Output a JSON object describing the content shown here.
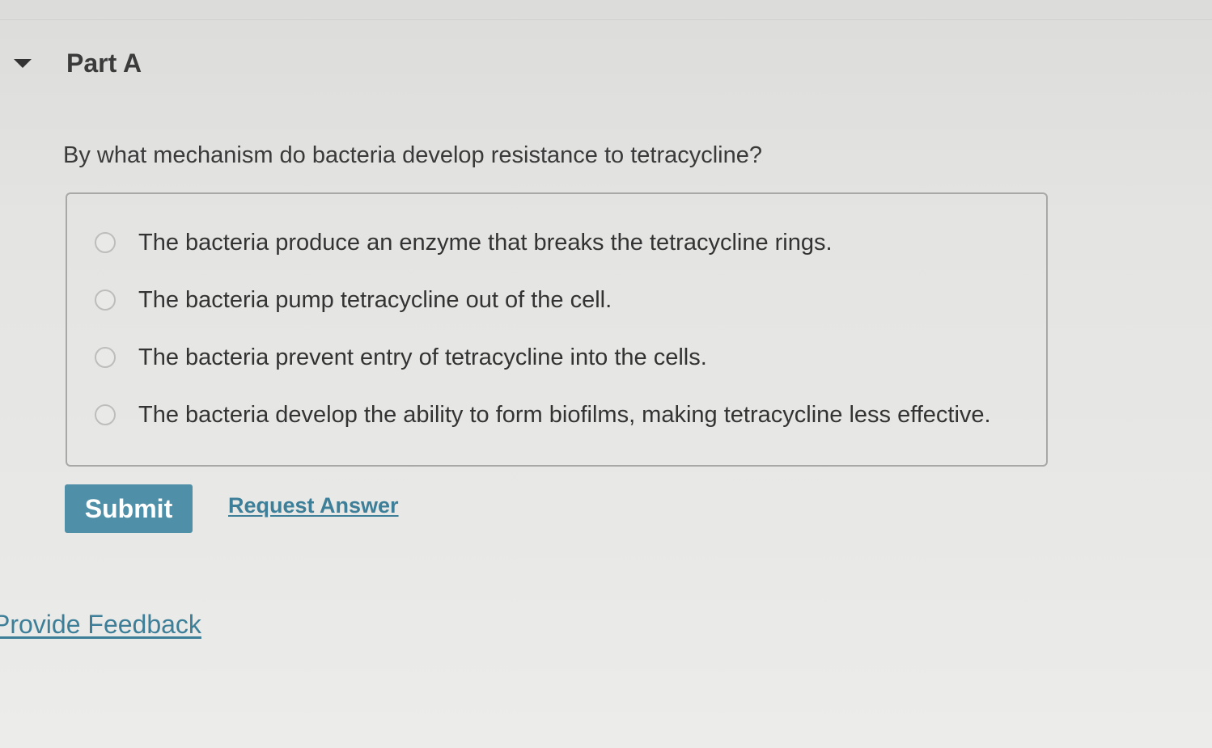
{
  "part": {
    "title": "Part A",
    "collapse_icon": "caret-down-icon"
  },
  "question": {
    "text": "By what mechanism do bacteria develop resistance to tetracycline?"
  },
  "options": [
    {
      "label": "The bacteria produce an enzyme that breaks the tetracycline rings.",
      "selected": false
    },
    {
      "label": "The bacteria pump tetracycline out of the cell.",
      "selected": false
    },
    {
      "label": "The bacteria prevent entry of tetracycline into the cells.",
      "selected": false
    },
    {
      "label": "The bacteria develop the ability to form biofilms, making tetracycline less effective.",
      "selected": false
    }
  ],
  "actions": {
    "submit_label": "Submit",
    "request_answer_label": "Request Answer"
  },
  "footer": {
    "feedback_label": "Provide Feedback"
  },
  "colors": {
    "accent": "#4f90a8",
    "link": "#3d7f98"
  }
}
